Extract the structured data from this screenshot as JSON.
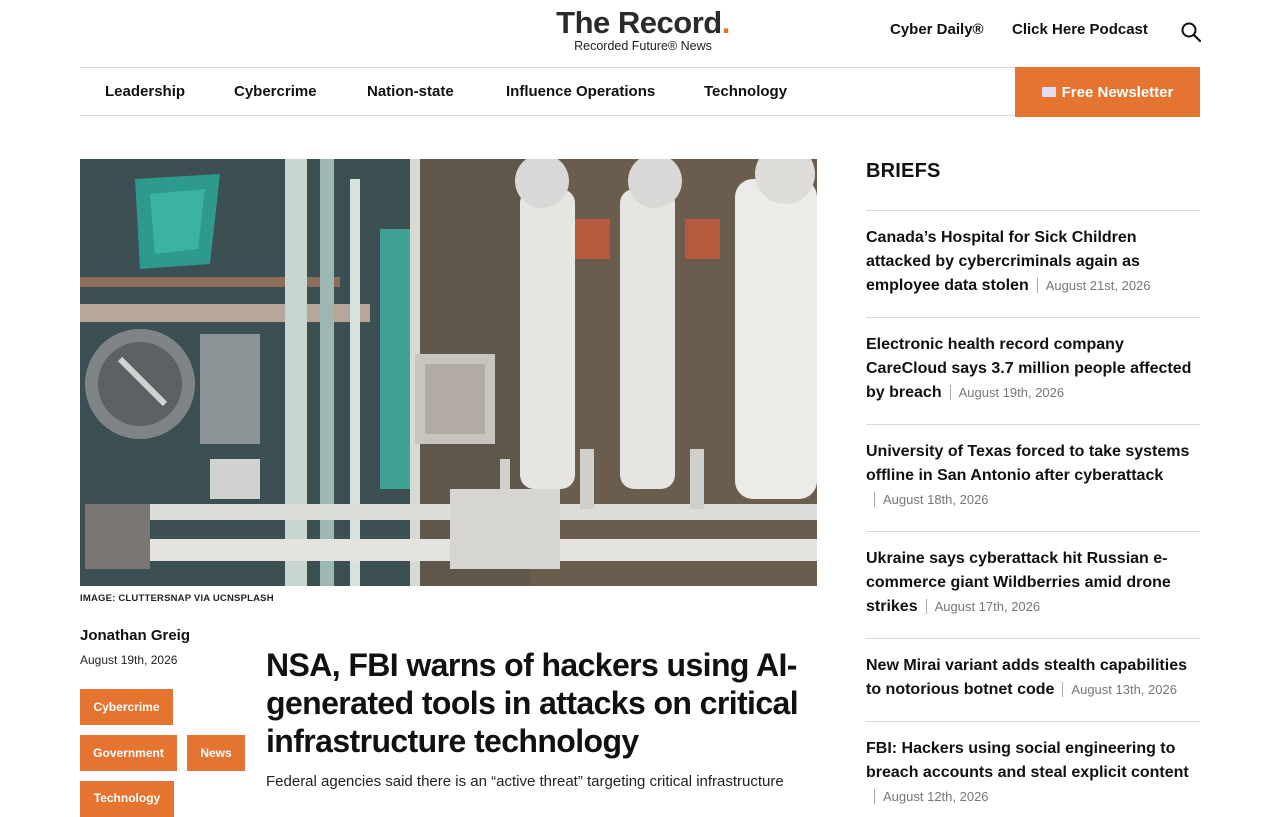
{
  "header": {
    "logo_main": "The Record",
    "logo_dot": ".",
    "logo_sub": "Recorded Future® News",
    "links": [
      "Cyber Daily®",
      "Click Here Podcast"
    ]
  },
  "nav": {
    "items": [
      "Leadership",
      "Cybercrime",
      "Nation-state",
      "Influence Operations",
      "Technology"
    ],
    "newsletter_label": "Free Newsletter"
  },
  "article": {
    "image_credit": "IMAGE: CLUTTERSNAP VIA UCNSPLASH",
    "author": "Jonathan Greig",
    "date": "August 19th, 2026",
    "tags": [
      "Cybercrime",
      "Government",
      "News",
      "Technology"
    ],
    "headline": "NSA, FBI warns of hackers using AI-generated tools in attacks on critical infrastructure technology",
    "lede": "Federal agencies said there is an “active threat” targeting critical infrastructure"
  },
  "briefs": {
    "title": "BRIEFS",
    "items": [
      {
        "title": "Canada’s Hospital for Sick Children attacked by cybercriminals again as employee data stolen",
        "date": "August 21st, 2026"
      },
      {
        "title": "Electronic health record company CareCloud says 3.7 million people affected by breach",
        "date": "August 19th, 2026"
      },
      {
        "title": "University of Texas forced to take systems offline in San Antonio after cyberattack",
        "date": "August 18th, 2026"
      },
      {
        "title": "Ukraine says cyberattack hit Russian e-commerce giant Wildberries amid drone strikes",
        "date": "August 17th, 2026"
      },
      {
        "title": "New Mirai variant adds stealth capabilities to notorious botnet code",
        "date": "August 13th, 2026"
      },
      {
        "title": "FBI: Hackers using social engineering to breach accounts and steal explicit content",
        "date": "August 12th, 2026"
      }
    ]
  },
  "colors": {
    "accent": "#e4742f",
    "separator": "#d8d8d8"
  },
  "icons": {
    "search": "search-icon",
    "newsletter": "mail-icon"
  }
}
